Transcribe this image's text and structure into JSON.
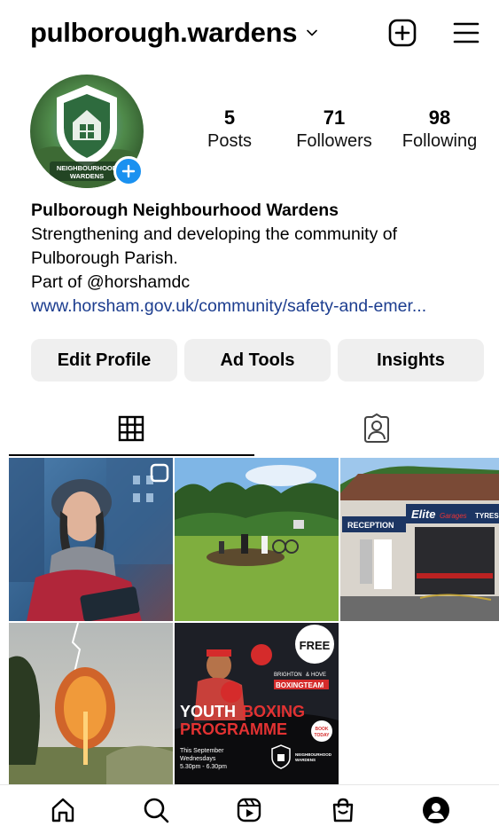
{
  "header": {
    "username": "pulborough.wardens"
  },
  "profile": {
    "stats": {
      "posts_count": "5",
      "posts_label": "Posts",
      "followers_count": "71",
      "followers_label": "Followers",
      "following_count": "98",
      "following_label": "Following"
    },
    "bio": {
      "name": "Pulborough Neighbourhood Wardens",
      "line1": "Strengthening and developing the community of",
      "line2": "Pulborough Parish.",
      "line3": "Part of @horshamdc",
      "link": "www.horsham.gov.uk/community/safety-and-emer..."
    },
    "avatar_text_line1": "NEIGHBOURHOOD",
    "avatar_text_line2": "WARDENS"
  },
  "actions": {
    "edit_profile": "Edit Profile",
    "ad_tools": "Ad Tools",
    "insights": "Insights"
  },
  "posts": {
    "post3_sign1": "RECEPTION",
    "post3_sign2": "Elite",
    "post3_sign3": "Garages",
    "post3_sign4": "TYRES",
    "post5_badge": "FREE",
    "post5_brand1": "BRIGHTON",
    "post5_brand_amp": "&",
    "post5_brand2": "HOVE",
    "post5_brand3": "BOXINGTEAM",
    "post5_title1": "YOUTH",
    "post5_title2": "BOXING",
    "post5_title3": "PROGRAMME",
    "post5_book1": "BOOK",
    "post5_book2": "TODAY",
    "post5_info1": "This September",
    "post5_info2": "Wednesdays",
    "post5_info3": "5.30pm - 6.30pm",
    "post5_logo1": "NEIGHBOURHOOD",
    "post5_logo2": "WARDENS"
  },
  "colors": {
    "link": "#1c3d8f",
    "accent": "#1a91f0",
    "button_bg": "#efefef"
  }
}
